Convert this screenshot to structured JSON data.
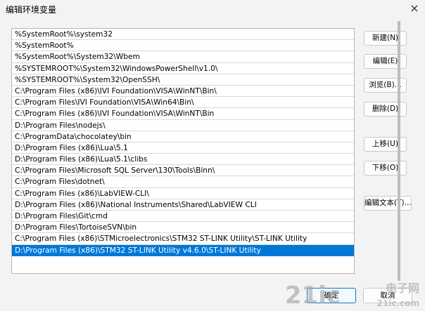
{
  "window": {
    "title": "编辑环境变量",
    "close_glyph": "×"
  },
  "paths": [
    "%SystemRoot%\\system32",
    "%SystemRoot%",
    "%SystemRoot%\\System32\\Wbem",
    "%SYSTEMROOT%\\System32\\WindowsPowerShell\\v1.0\\",
    "%SYSTEMROOT%\\System32\\OpenSSH\\",
    "C:\\Program Files (x86)\\IVI Foundation\\VISA\\WinNT\\Bin\\",
    "C:\\Program Files\\IVI Foundation\\VISA\\Win64\\Bin\\",
    "C:\\Program Files (x86)\\IVI Foundation\\VISA\\WinNT\\Bin",
    "D:\\Program Files\\nodejs\\",
    "C:\\ProgramData\\chocolatey\\bin",
    "D:\\Program Files (x86)\\Lua\\5.1",
    "D:\\Program Files (x86)\\Lua\\5.1\\clibs",
    "C:\\Program Files\\Microsoft SQL Server\\130\\Tools\\Binn\\",
    "C:\\Program Files\\dotnet\\",
    "C:\\Program Files (x86)\\LabVIEW-CLI\\",
    "D:\\Program Files (x86)\\National Instruments\\Shared\\LabVIEW CLI",
    "D:\\Program Files\\Git\\cmd",
    "D:\\Program Files\\TortoiseSVN\\bin",
    "C:\\Program Files (x86)\\STMicroelectronics\\STM32 ST-LINK Utility\\ST-LINK Utility",
    "D:\\Program Files (x86)\\STM32 ST-LINK Utility v4.6.0\\ST-LINK Utility"
  ],
  "selected_index": 19,
  "buttons": {
    "new": "新建(N)",
    "edit": "编辑(E)",
    "browse": "浏览(B)...",
    "delete": "删除(D)",
    "move_up": "上移(U)",
    "move_down": "下移(O)",
    "edit_text": "编辑文本(T)...",
    "ok": "确定",
    "cancel": "取消"
  },
  "watermark": {
    "logo": "21ic",
    "cn": "电子网",
    "domain": "21ic.com"
  },
  "colors": {
    "selection": "#0078d7",
    "background": "#f3f3f3"
  }
}
